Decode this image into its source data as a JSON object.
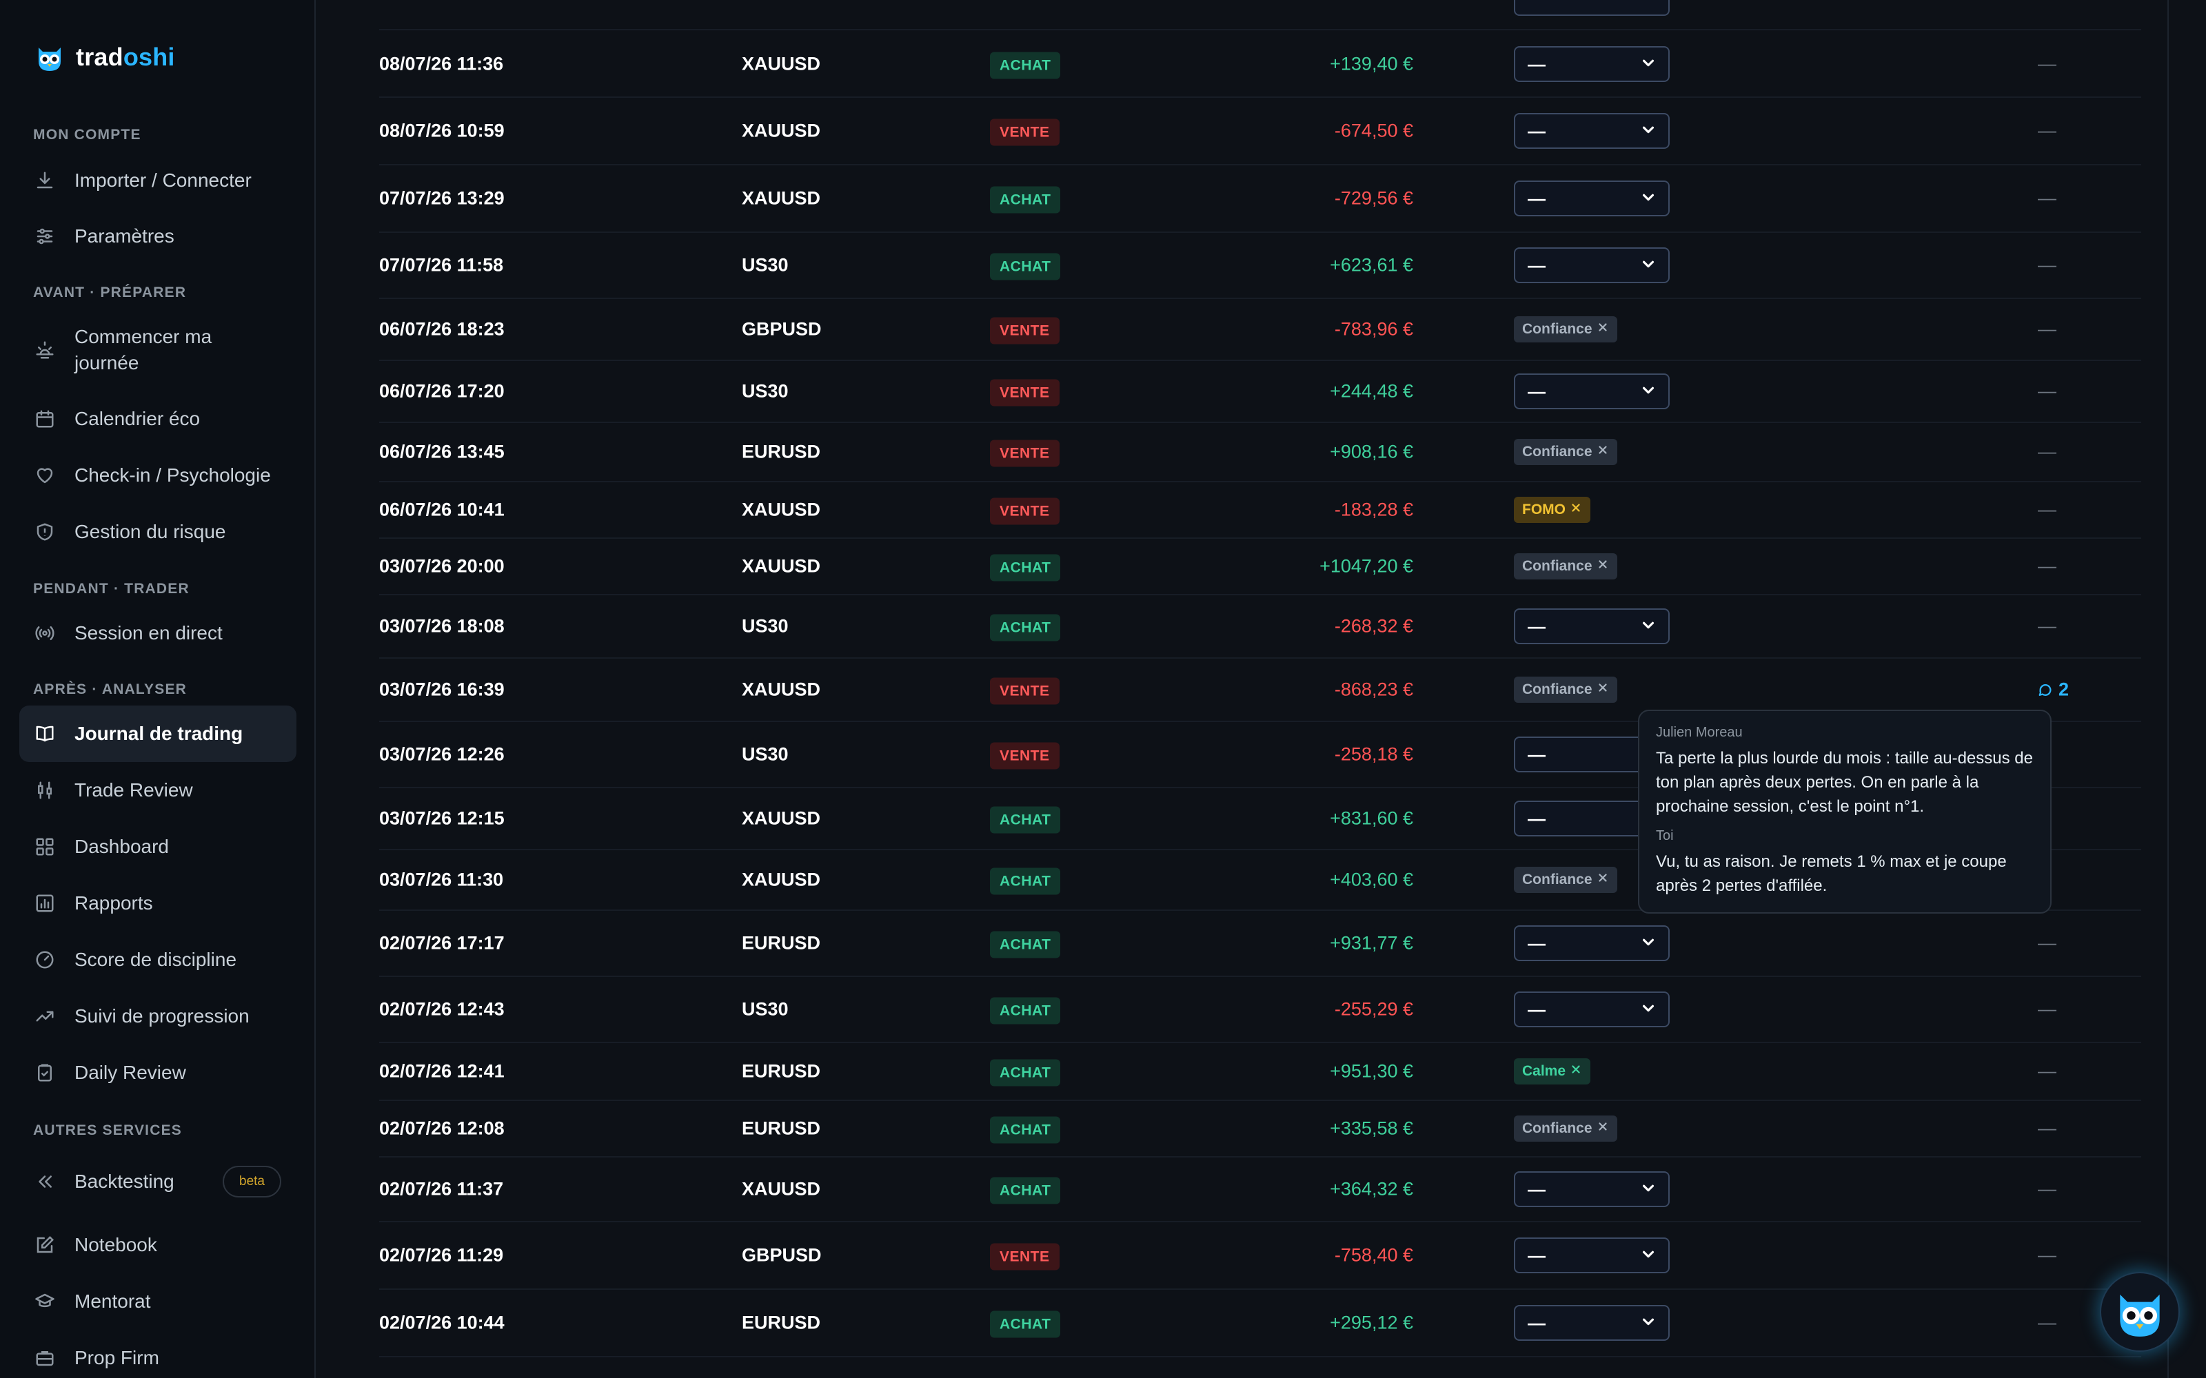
{
  "brand": {
    "name_main": "trad",
    "name_accent": "oshi"
  },
  "sidebar": {
    "sections": [
      {
        "title": "MON COMPTE"
      },
      {
        "title": "AVANT · PRÉPARER"
      },
      {
        "title": "PENDANT · TRADER"
      },
      {
        "title": "APRÈS · ANALYSER"
      },
      {
        "title": "AUTRES SERVICES"
      }
    ],
    "items": [
      {
        "label": "Importer / Connecter",
        "icon": "download-icon"
      },
      {
        "label": "Paramètres",
        "icon": "sliders-icon"
      },
      {
        "label": "Commencer ma",
        "label2": "journée",
        "icon": "sunrise-icon"
      },
      {
        "label": "Calendrier éco",
        "icon": "calendar-icon"
      },
      {
        "label": "Check-in / Psychologie",
        "icon": "heart-icon"
      },
      {
        "label": "Gestion du risque",
        "icon": "shield-icon"
      },
      {
        "label": "Session en direct",
        "icon": "broadcast-icon"
      },
      {
        "label": "Journal de trading",
        "icon": "book-icon",
        "active": true
      },
      {
        "label": "Trade Review",
        "icon": "candles-icon"
      },
      {
        "label": "Dashboard",
        "icon": "grid-icon"
      },
      {
        "label": "Rapports",
        "icon": "report-icon"
      },
      {
        "label": "Score de discipline",
        "icon": "gauge-icon"
      },
      {
        "label": "Suivi de progression",
        "icon": "trend-icon"
      },
      {
        "label": "Daily Review",
        "icon": "clipboard-icon"
      },
      {
        "label": "Backtesting",
        "icon": "rewind-icon",
        "badge": "beta"
      },
      {
        "label": "Notebook",
        "icon": "edit-icon"
      },
      {
        "label": "Mentorat",
        "icon": "graduation-icon"
      },
      {
        "label": "Prop Firm",
        "icon": "briefcase-icon"
      }
    ]
  },
  "trades": [
    {
      "date": "08/07/26 11:36",
      "symbol": "XAUUSD",
      "side": "ACHAT",
      "pnl": "+139,40 €",
      "emotion": "—",
      "emotion_type": "select",
      "comments": "—"
    },
    {
      "date": "08/07/26 10:59",
      "symbol": "XAUUSD",
      "side": "VENTE",
      "pnl": "-674,50 €",
      "emotion": "—",
      "emotion_type": "select",
      "comments": "—"
    },
    {
      "date": "07/07/26 13:29",
      "symbol": "XAUUSD",
      "side": "ACHAT",
      "pnl": "-729,56 €",
      "emotion": "—",
      "emotion_type": "select",
      "comments": "—"
    },
    {
      "date": "07/07/26 11:58",
      "symbol": "US30",
      "side": "ACHAT",
      "pnl": "+623,61 €",
      "emotion": "—",
      "emotion_type": "select",
      "comments": "—"
    },
    {
      "date": "06/07/26 18:23",
      "symbol": "GBPUSD",
      "side": "VENTE",
      "pnl": "-783,96 €",
      "emotion": "Confiance",
      "emotion_type": "tag",
      "comments": "—"
    },
    {
      "date": "06/07/26 17:20",
      "symbol": "US30",
      "side": "VENTE",
      "pnl": "+244,48 €",
      "emotion": "—",
      "emotion_type": "select",
      "comments": "—"
    },
    {
      "date": "06/07/26 13:45",
      "symbol": "EURUSD",
      "side": "VENTE",
      "pnl": "+908,16 €",
      "emotion": "Confiance",
      "emotion_type": "tag",
      "comments": "—"
    },
    {
      "date": "06/07/26 10:41",
      "symbol": "XAUUSD",
      "side": "VENTE",
      "pnl": "-183,28 €",
      "emotion": "FOMO",
      "emotion_type": "fomo",
      "comments": "—"
    },
    {
      "date": "03/07/26 20:00",
      "symbol": "XAUUSD",
      "side": "ACHAT",
      "pnl": "+1047,20 €",
      "emotion": "Confiance",
      "emotion_type": "tag",
      "comments": "—"
    },
    {
      "date": "03/07/26 18:08",
      "symbol": "US30",
      "side": "ACHAT",
      "pnl": "-268,32 €",
      "emotion": "—",
      "emotion_type": "select",
      "comments": "—"
    },
    {
      "date": "03/07/26 16:39",
      "symbol": "XAUUSD",
      "side": "VENTE",
      "pnl": "-868,23 €",
      "emotion": "Confiance",
      "emotion_type": "tag",
      "comments": "2",
      "has_comments": true
    },
    {
      "date": "03/07/26 12:26",
      "symbol": "US30",
      "side": "VENTE",
      "pnl": "-258,18 €",
      "emotion": "—",
      "emotion_type": "select",
      "comments": ""
    },
    {
      "date": "03/07/26 12:15",
      "symbol": "XAUUSD",
      "side": "ACHAT",
      "pnl": "+831,60 €",
      "emotion": "—",
      "emotion_type": "select",
      "comments": ""
    },
    {
      "date": "03/07/26 11:30",
      "symbol": "XAUUSD",
      "side": "ACHAT",
      "pnl": "+403,60 €",
      "emotion": "Confiance",
      "emotion_type": "tag",
      "comments": ""
    },
    {
      "date": "02/07/26 17:17",
      "symbol": "EURUSD",
      "side": "ACHAT",
      "pnl": "+931,77 €",
      "emotion": "—",
      "emotion_type": "select",
      "comments": "—"
    },
    {
      "date": "02/07/26 12:43",
      "symbol": "US30",
      "side": "ACHAT",
      "pnl": "-255,29 €",
      "emotion": "—",
      "emotion_type": "select",
      "comments": "—"
    },
    {
      "date": "02/07/26 12:41",
      "symbol": "EURUSD",
      "side": "ACHAT",
      "pnl": "+951,30 €",
      "emotion": "Calme",
      "emotion_type": "calm",
      "comments": "—"
    },
    {
      "date": "02/07/26 12:08",
      "symbol": "EURUSD",
      "side": "ACHAT",
      "pnl": "+335,58 €",
      "emotion": "Confiance",
      "emotion_type": "tag",
      "comments": "—"
    },
    {
      "date": "02/07/26 11:37",
      "symbol": "XAUUSD",
      "side": "ACHAT",
      "pnl": "+364,32 €",
      "emotion": "—",
      "emotion_type": "select",
      "comments": "—"
    },
    {
      "date": "02/07/26 11:29",
      "symbol": "GBPUSD",
      "side": "VENTE",
      "pnl": "-758,40 €",
      "emotion": "—",
      "emotion_type": "select",
      "comments": "—"
    },
    {
      "date": "02/07/26 10:44",
      "symbol": "EURUSD",
      "side": "ACHAT",
      "pnl": "+295,12 €",
      "emotion": "—",
      "emotion_type": "select",
      "comments": "—"
    }
  ],
  "popover": {
    "author1": "Julien Moreau",
    "message1": "Ta perte la plus lourde du mois : taille au-dessus de ton plan après deux pertes. On en parle à la prochaine session, c'est le point n°1.",
    "author2": "Toi",
    "message2": "Vu, tu as raison. Je remets 1 % max et je coupe après 2 pertes d'affilée."
  },
  "colors": {
    "accent": "#2bb6ff",
    "positive": "#3fcf9b",
    "negative": "#ff5454",
    "buy_bg": "#11352b",
    "sell_bg": "#3d1518",
    "fomo": "#f1c232"
  }
}
